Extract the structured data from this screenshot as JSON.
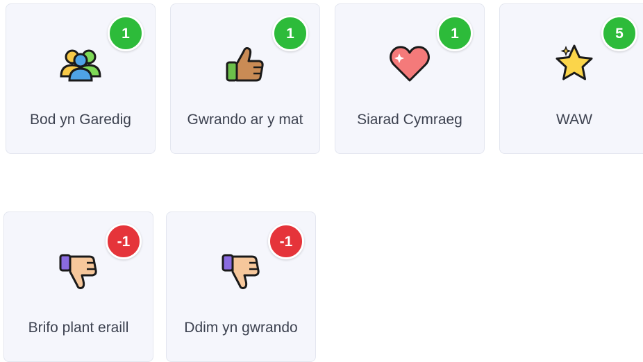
{
  "behaviours": {
    "positive": [
      {
        "label": "Bod yn Garedig",
        "points": "1",
        "icon": "two-people-icon"
      },
      {
        "label": "Gwrando ar y mat",
        "points": "1",
        "icon": "thumbs-up-icon"
      },
      {
        "label": "Siarad Cymraeg",
        "points": "1",
        "icon": "heart-icon"
      },
      {
        "label": "WAW",
        "points": "5",
        "icon": "star-icon"
      }
    ],
    "negative": [
      {
        "label": "Brifo plant eraill",
        "points": "-1",
        "icon": "thumbs-down-icon"
      },
      {
        "label": "Ddim yn gwrando",
        "points": "-1",
        "icon": "thumbs-down-icon"
      }
    ]
  },
  "colors": {
    "positive_badge": "#2dbb3a",
    "negative_badge": "#e5343a",
    "card_background": "#f5f6fc"
  }
}
